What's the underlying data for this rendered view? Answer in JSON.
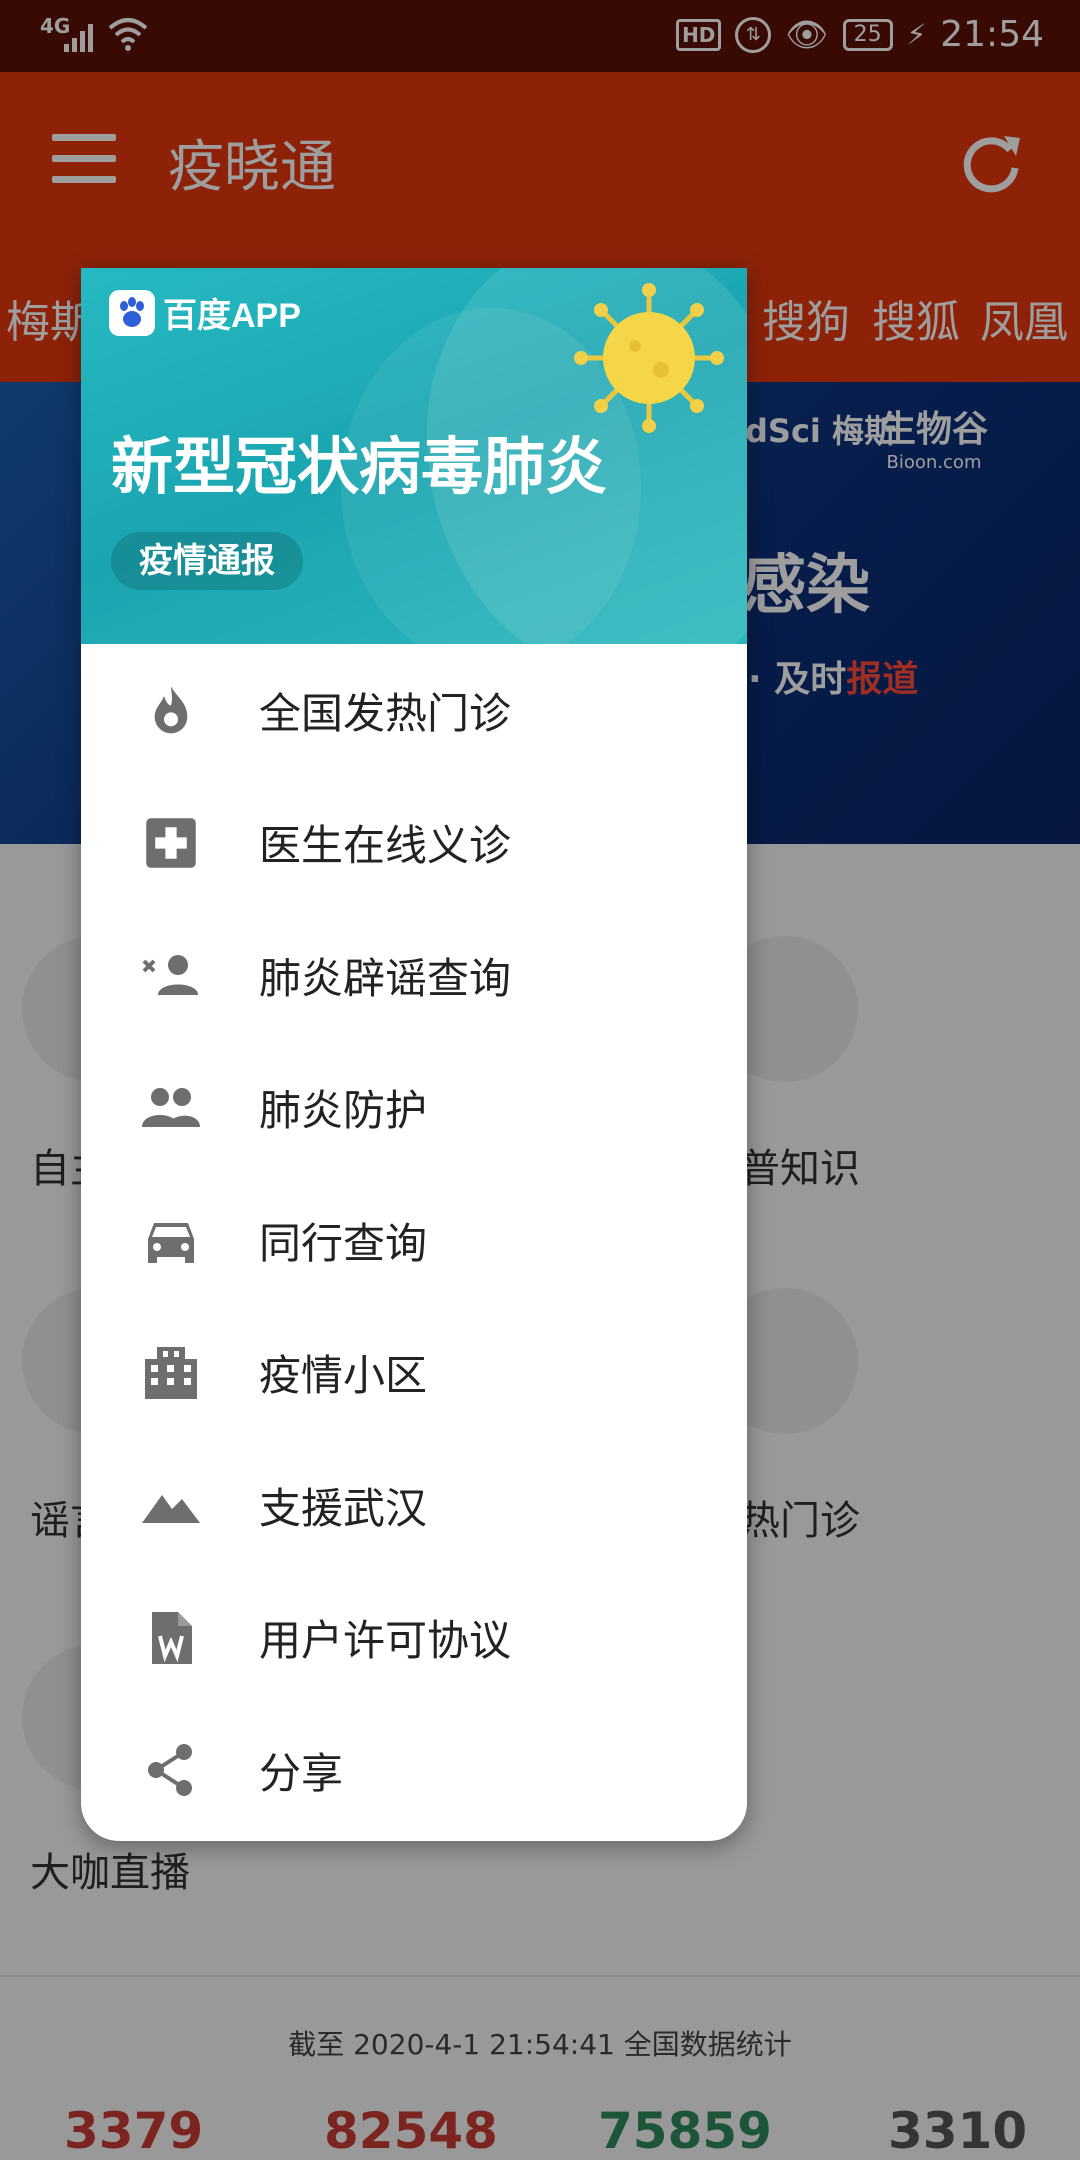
{
  "status_bar": {
    "network": "4G",
    "hd": "HD",
    "battery": "25",
    "time": "21:54"
  },
  "app_bar": {
    "title": "疫晓通"
  },
  "tabs": [
    "梅斯",
    "搜狗",
    "搜狐",
    "凤凰"
  ],
  "banner": {
    "logo_partner": "dSci 梅斯",
    "logo_bioon": "生物谷",
    "logo_bioon_sub": "Bioon.com",
    "headline": "感染",
    "tagline_prefix": "· 及时",
    "tagline_highlight": "报道"
  },
  "grid_labels": {
    "r1_left": "自主",
    "r1_right": "普知识",
    "r2_left": "谣言",
    "r2_right": "热门诊",
    "r3_left": "大咖直播"
  },
  "popup": {
    "brand": "百度APP",
    "title": "新型冠状病毒肺炎",
    "pill": "疫情通报",
    "items": [
      {
        "label": "全国发热门诊",
        "icon": "fire-icon"
      },
      {
        "label": "医生在线义诊",
        "icon": "medical-plus-icon"
      },
      {
        "label": "肺炎辟谣查询",
        "icon": "person-remove-icon"
      },
      {
        "label": "肺炎防护",
        "icon": "people-icon"
      },
      {
        "label": "同行查询",
        "icon": "car-icon"
      },
      {
        "label": "疫情小区",
        "icon": "building-icon"
      },
      {
        "label": "支援武汉",
        "icon": "mountain-icon"
      },
      {
        "label": "用户许可协议",
        "icon": "document-icon"
      },
      {
        "label": "分享",
        "icon": "share-icon"
      }
    ]
  },
  "stats": {
    "caption": "截至 2020-4-1 21:54:41 全国数据统计",
    "values": [
      "3379",
      "82548",
      "75859",
      "3310"
    ],
    "colors": [
      "#c93a35",
      "#c93a35",
      "#2e8a5a",
      "#555555"
    ]
  },
  "colors": {
    "primary": "#e4380f",
    "status_bar": "#5d0f05",
    "popup_header": "#1aa5b0"
  }
}
